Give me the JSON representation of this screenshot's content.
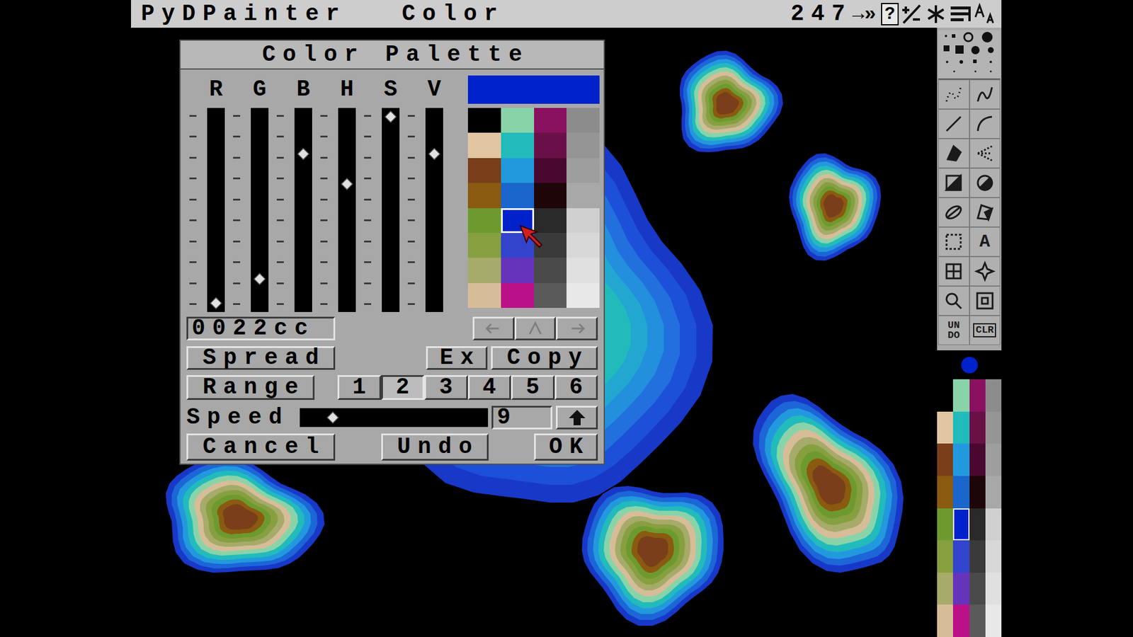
{
  "title_bar": {
    "app": "PyDPainter",
    "mode": "Color",
    "color_number": "247",
    "arrows": "→»",
    "help": "?"
  },
  "toolbar": {
    "text_tool": "A",
    "undo": "UNDO",
    "clear": "CLR"
  },
  "current_color": "#0022cc",
  "palette": [
    {
      "color": "#000000",
      "selected": false
    },
    {
      "color": "#88d4a8",
      "selected": false
    },
    {
      "color": "#8a1060",
      "selected": false
    },
    {
      "color": "#8c8c8c",
      "selected": false
    },
    {
      "color": "#e2c6a2",
      "selected": false
    },
    {
      "color": "#22bbbb",
      "selected": false
    },
    {
      "color": "#6a1048",
      "selected": false
    },
    {
      "color": "#959595",
      "selected": false
    },
    {
      "color": "#7a3e1a",
      "selected": false
    },
    {
      "color": "#2299dd",
      "selected": false
    },
    {
      "color": "#4a0830",
      "selected": false
    },
    {
      "color": "#9e9e9e",
      "selected": false
    },
    {
      "color": "#8a5a10",
      "selected": false
    },
    {
      "color": "#1a66cc",
      "selected": false
    },
    {
      "color": "#1e0508",
      "selected": false
    },
    {
      "color": "#a8a8a8",
      "selected": false
    },
    {
      "color": "#6d9a2e",
      "selected": false
    },
    {
      "color": "#0022cc",
      "selected": true
    },
    {
      "color": "#2a2a2a",
      "selected": false
    },
    {
      "color": "#d0d0d0",
      "selected": false
    },
    {
      "color": "#86a040",
      "selected": false
    },
    {
      "color": "#3344cc",
      "selected": false
    },
    {
      "color": "#3a3a3a",
      "selected": false
    },
    {
      "color": "#d8d8d8",
      "selected": false
    },
    {
      "color": "#a6ab6a",
      "selected": false
    },
    {
      "color": "#6633bb",
      "selected": false
    },
    {
      "color": "#4a4a4a",
      "selected": false
    },
    {
      "color": "#e0e0e0",
      "selected": false
    },
    {
      "color": "#d6bd98",
      "selected": false
    },
    {
      "color": "#bb1188",
      "selected": false
    },
    {
      "color": "#5a5a5a",
      "selected": false
    },
    {
      "color": "#e8e8e8",
      "selected": false
    }
  ],
  "dialog": {
    "title": "Color Palette",
    "sliders": [
      {
        "label": "R",
        "level": 0
      },
      {
        "label": "G",
        "level": 0.13
      },
      {
        "label": "B",
        "level": 0.8
      },
      {
        "label": "H",
        "level": 0.64
      },
      {
        "label": "S",
        "level": 1
      },
      {
        "label": "V",
        "level": 0.8
      }
    ],
    "preview_color": "#0022cc",
    "hex": "0022cc",
    "nav_buttons": [
      {
        "kind": "left",
        "disabled": true
      },
      {
        "kind": "up",
        "disabled": true
      },
      {
        "kind": "right",
        "disabled": true
      }
    ],
    "spread": "Spread",
    "ex": "Ex",
    "copy": "Copy",
    "range": "Range",
    "ranges": [
      {
        "label": "1",
        "selected": false
      },
      {
        "label": "2",
        "selected": true
      },
      {
        "label": "3",
        "selected": false
      },
      {
        "label": "4",
        "selected": false
      },
      {
        "label": "5",
        "selected": false
      },
      {
        "label": "6",
        "selected": false
      }
    ],
    "speed": {
      "label": "Speed",
      "level": 0.14,
      "value": "9"
    },
    "cancel": "Cancel",
    "undo": "Undo",
    "ok": "OK"
  }
}
